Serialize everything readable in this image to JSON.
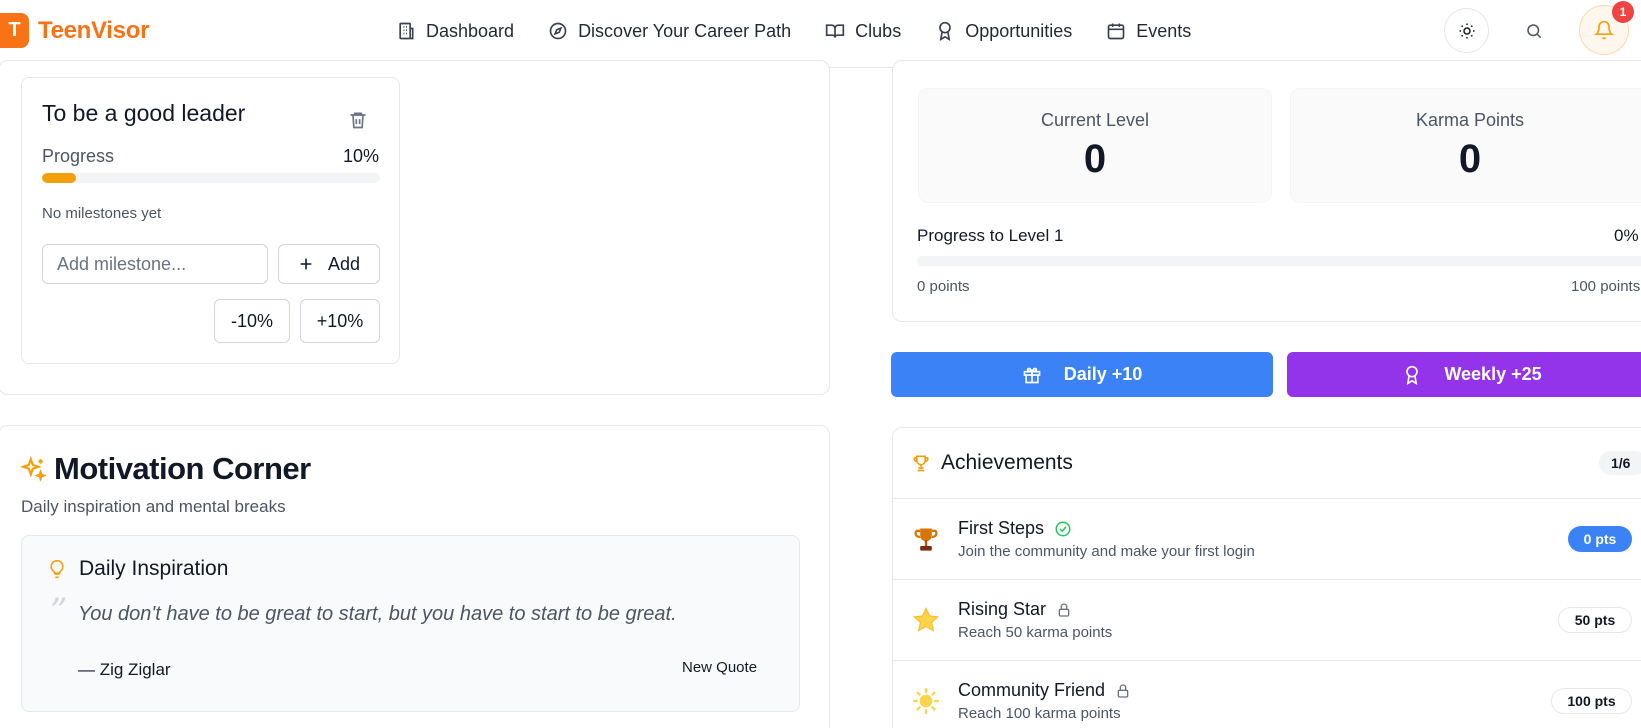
{
  "header": {
    "logo_letter": "T",
    "brand": "TeenVisor",
    "nav": [
      {
        "label": "Dashboard",
        "icon": "building-icon"
      },
      {
        "label": "Discover Your Career Path",
        "icon": "compass-icon"
      },
      {
        "label": "Clubs",
        "icon": "book-open-icon"
      },
      {
        "label": "Opportunities",
        "icon": "award-icon"
      },
      {
        "label": "Events",
        "icon": "calendar-icon"
      }
    ],
    "notification_count": "1"
  },
  "goal": {
    "title": "To be a good leader",
    "progress_label": "Progress",
    "progress_value": "10%",
    "progress_fraction": 0.1,
    "no_milestones": "No milestones yet",
    "milestone_placeholder": "Add milestone...",
    "add_label": "Add",
    "minus_label": "-10%",
    "plus_label": "+10%"
  },
  "motivation": {
    "title": "Motivation Corner",
    "subtitle": "Daily inspiration and mental breaks",
    "card_title": "Daily Inspiration",
    "quote_mark": "”",
    "quote": "You don't have to be great to start, but you have to start to be great.",
    "author": "— Zig Ziglar",
    "new_quote_label": "New Quote"
  },
  "stats": {
    "level_label": "Current Level",
    "level_value": "0",
    "karma_label": "Karma Points",
    "karma_value": "0",
    "progress_label": "Progress to Level 1",
    "progress_pct": "0%",
    "progress_fraction": 0,
    "min_label": "0 points",
    "max_label": "100 points"
  },
  "rewards": {
    "daily_label": "Daily +10",
    "weekly_label": "Weekly +25",
    "daily_color": "#3b82f6",
    "weekly_color": "#9333ea"
  },
  "achievements": {
    "title": "Achievements",
    "count": "1/6",
    "items": [
      {
        "name": "First Steps",
        "desc": "Join the community and make your first login",
        "points": "0 pts",
        "status": "earned",
        "icon": "trophy-icon"
      },
      {
        "name": "Rising Star",
        "desc": "Reach 50 karma points",
        "points": "50 pts",
        "status": "locked",
        "icon": "star-icon"
      },
      {
        "name": "Community Friend",
        "desc": "Reach 100 karma points",
        "points": "100 pts",
        "status": "locked",
        "icon": "sun-icon"
      }
    ]
  }
}
